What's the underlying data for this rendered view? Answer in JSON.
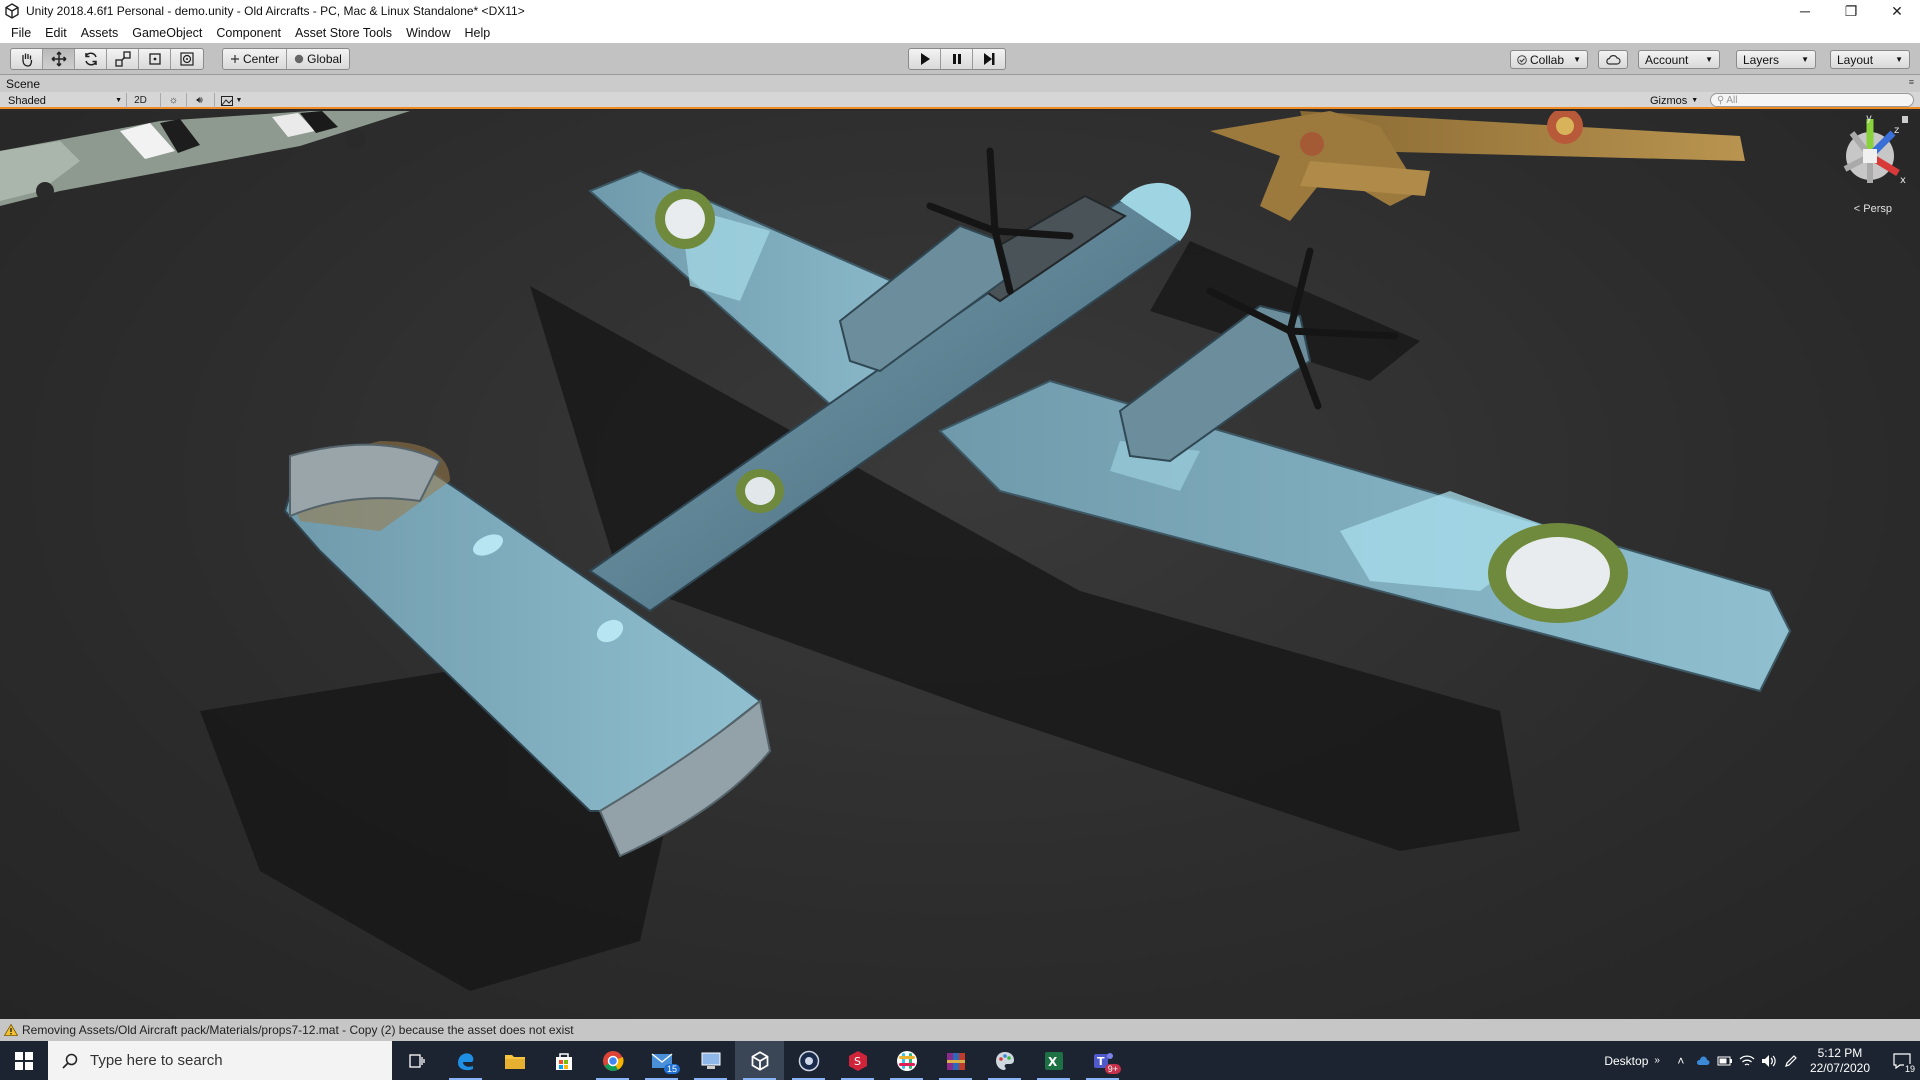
{
  "window": {
    "title": "Unity 2018.4.6f1 Personal - demo.unity - Old Aircrafts - PC, Mac & Linux Standalone* <DX11>",
    "minimize": "─",
    "restore": "❐",
    "close": "✕"
  },
  "menu": [
    "File",
    "Edit",
    "Assets",
    "GameObject",
    "Component",
    "Asset Store Tools",
    "Window",
    "Help"
  ],
  "toolbar": {
    "pivot": "Center",
    "space": "Global",
    "collab": "Collab",
    "account": "Account",
    "layers": "Layers",
    "layout": "Layout"
  },
  "scene_tab": {
    "label": "Scene"
  },
  "scene_toolbar": {
    "shading": "Shaded",
    "mode_2d": "2D",
    "gizmos": "Gizmos",
    "search_placeholder": "All"
  },
  "viewport": {
    "projection": "< Persp"
  },
  "gizmo_axes": {
    "y": "y",
    "z": "z",
    "x": "x"
  },
  "status": {
    "message": "Removing Assets/Old Aircraft pack/Materials/props7-12.mat - Copy (2) because the asset does not exist"
  },
  "taskbar": {
    "search_placeholder": "Type here to search",
    "mail_badge": "15",
    "teams_badge": "9+",
    "desktop_label": "Desktop",
    "time": "5:12 PM",
    "date": "22/07/2020",
    "notif_count": "19"
  },
  "colors": {
    "accent_orange": "#f08a24",
    "toolbar_bg": "#c2c2c2",
    "taskbar_bg": "#1c2431",
    "camo_light": "#8fd0e2",
    "camo_dark": "#4f7a8c"
  }
}
